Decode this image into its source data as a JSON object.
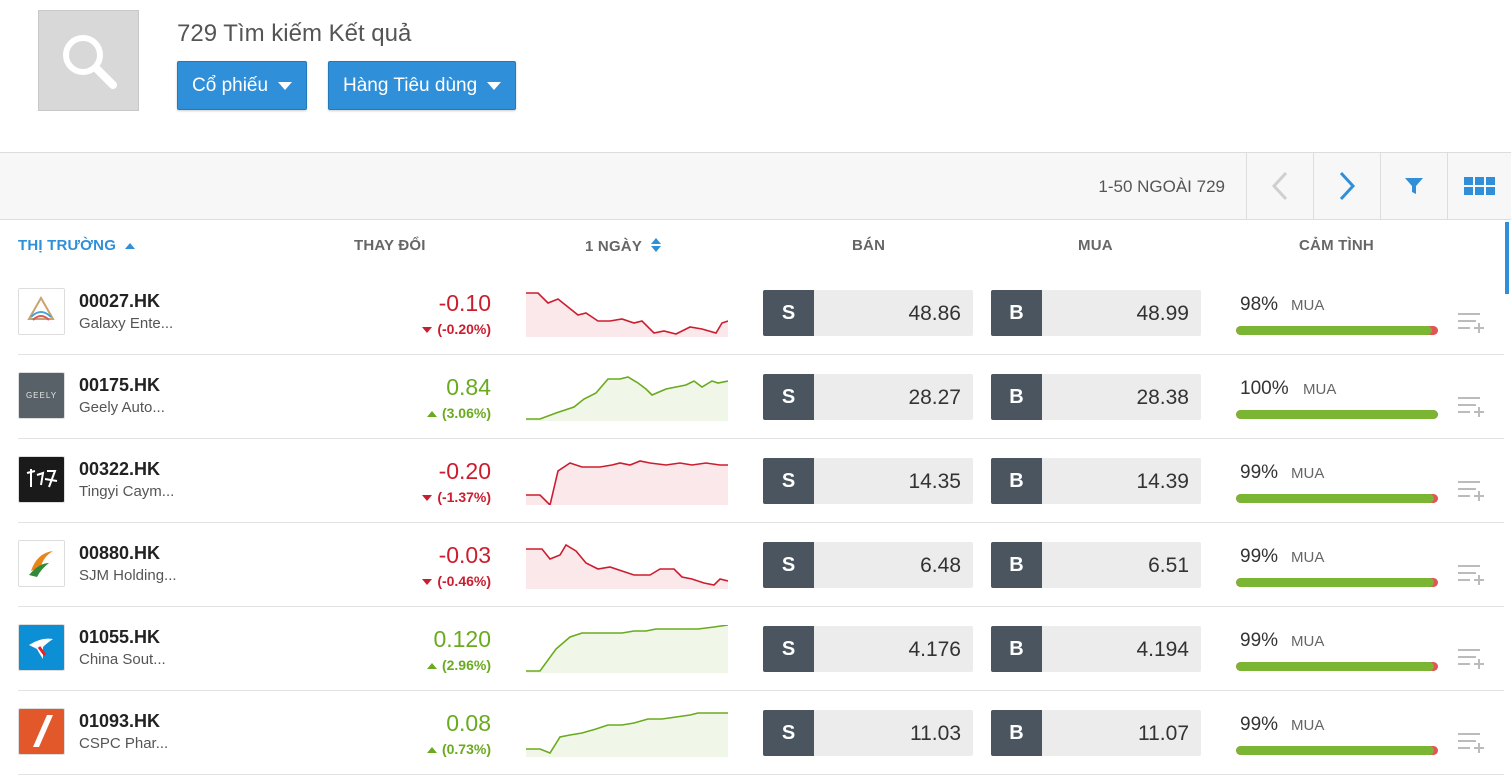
{
  "header": {
    "results_title": "729 Tìm kiếm Kết quả",
    "filter_type": "Cổ phiếu",
    "filter_category": "Hàng Tiêu dùng"
  },
  "toolbar": {
    "pager_text": "1-50 NGOÀI 729"
  },
  "columns": {
    "market": "THỊ TRƯỜNG",
    "change": "THAY ĐỔI",
    "one_day": "1 NGÀY",
    "sell": "BÁN",
    "buy": "MUA",
    "sentiment": "CẢM TÌNH"
  },
  "colors": {
    "accent": "#2f8fd8",
    "negative": "#cc1d2f",
    "positive": "#6aaa1f",
    "sentiment_fill": "#7bb534",
    "label_bg": "#4a5560"
  },
  "icons": {
    "search": "search-icon",
    "prev": "chevron-left-icon",
    "next": "chevron-right-icon",
    "filter": "filter-icon",
    "grid": "grid-view-icon",
    "watchlist": "add-to-watchlist-icon"
  },
  "rows": [
    {
      "symbol": "00027.HK",
      "name": "Galaxy Ente...",
      "change": "-0.10",
      "change_pct": "(-0.20%)",
      "dir": "neg",
      "sell_label": "S",
      "sell": "48.86",
      "buy_label": "B",
      "buy": "48.99",
      "sentiment_pct": "98%",
      "sentiment_label": "MUA",
      "sentiment_value": 98,
      "logo": "galaxy"
    },
    {
      "symbol": "00175.HK",
      "name": "Geely Auto...",
      "change": "0.84",
      "change_pct": "(3.06%)",
      "dir": "pos",
      "sell_label": "S",
      "sell": "28.27",
      "buy_label": "B",
      "buy": "28.38",
      "sentiment_pct": "100%",
      "sentiment_label": "MUA",
      "sentiment_value": 100,
      "logo": "geely",
      "logo_text": "GEELY"
    },
    {
      "symbol": "00322.HK",
      "name": "Tingyi Caym...",
      "change": "-0.20",
      "change_pct": "(-1.37%)",
      "dir": "neg",
      "sell_label": "S",
      "sell": "14.35",
      "buy_label": "B",
      "buy": "14.39",
      "sentiment_pct": "99%",
      "sentiment_label": "MUA",
      "sentiment_value": 99,
      "logo": "tingyi"
    },
    {
      "symbol": "00880.HK",
      "name": "SJM Holding...",
      "change": "-0.03",
      "change_pct": "(-0.46%)",
      "dir": "neg",
      "sell_label": "S",
      "sell": "6.48",
      "buy_label": "B",
      "buy": "6.51",
      "sentiment_pct": "99%",
      "sentiment_label": "MUA",
      "sentiment_value": 99,
      "logo": "sjm"
    },
    {
      "symbol": "01055.HK",
      "name": "China Sout...",
      "change": "0.120",
      "change_pct": "(2.96%)",
      "dir": "pos",
      "sell_label": "S",
      "sell": "4.176",
      "buy_label": "B",
      "buy": "4.194",
      "sentiment_pct": "99%",
      "sentiment_label": "MUA",
      "sentiment_value": 99,
      "logo": "csair"
    },
    {
      "symbol": "01093.HK",
      "name": "CSPC Phar...",
      "change": "0.08",
      "change_pct": "(0.73%)",
      "dir": "pos",
      "sell_label": "S",
      "sell": "11.03",
      "buy_label": "B",
      "buy": "11.07",
      "sentiment_pct": "99%",
      "sentiment_label": "MUA",
      "sentiment_value": 99,
      "logo": "cspc"
    }
  ]
}
